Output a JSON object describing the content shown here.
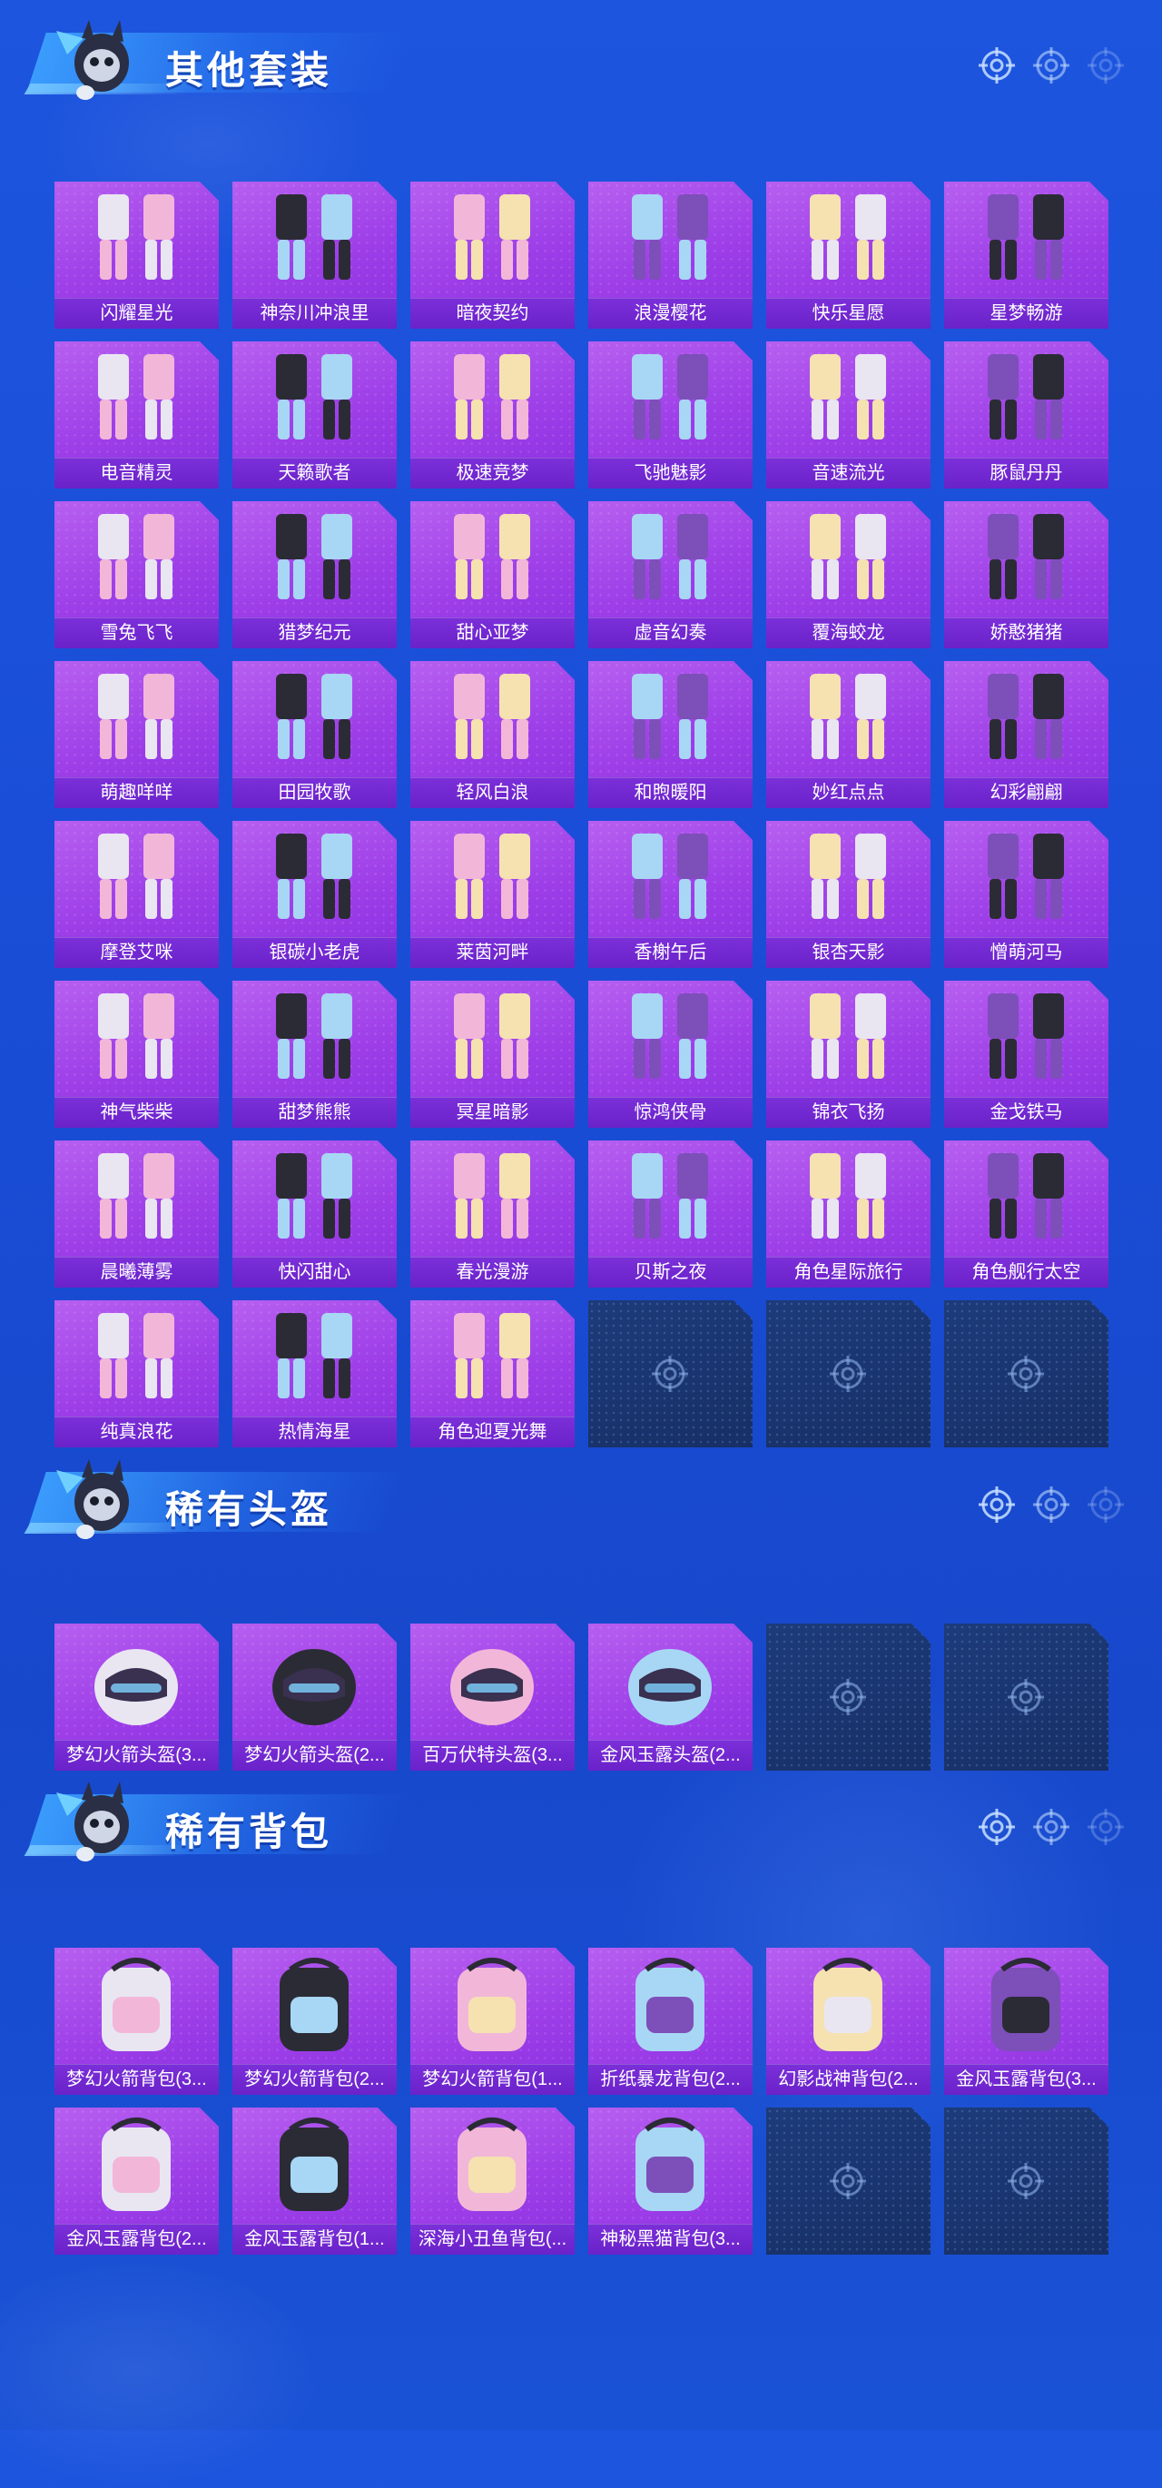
{
  "sections": [
    {
      "title": "其他套装",
      "items": [
        "闪耀星光",
        "神奈川冲浪里",
        "暗夜契约",
        "浪漫樱花",
        "快乐星愿",
        "星梦畅游",
        "电音精灵",
        "天籁歌者",
        "极速竞梦",
        "飞驰魅影",
        "音速流光",
        "豚鼠丹丹",
        "雪兔飞飞",
        "猎梦纪元",
        "甜心亚梦",
        "虚音幻奏",
        "覆海蛟龙",
        "娇憨猪猪",
        "萌趣咩咩",
        "田园牧歌",
        "轻风白浪",
        "和煦暖阳",
        "妙红点点",
        "幻彩翩翩",
        "摩登艾咪",
        "银碳小老虎",
        "莱茵河畔",
        "香榭午后",
        "银杏天影",
        "憎萌河马",
        "神气柴柴",
        "甜梦熊熊",
        "冥星暗影",
        "惊鸿侠骨",
        "锦衣飞扬",
        "金戈铁马",
        "晨曦薄雾",
        "快闪甜心",
        "春光漫游",
        "贝斯之夜",
        "角色星际旅行",
        "角色舰行太空",
        "纯真浪花",
        "热情海星",
        "角色迎夏光舞"
      ],
      "empty_slots": 3
    },
    {
      "title": "稀有头盔",
      "items": [
        "梦幻火箭头盔(3...",
        "梦幻火箭头盔(2...",
        "百万伏特头盔(3...",
        "金风玉露头盔(2..."
      ],
      "empty_slots": 2
    },
    {
      "title": "稀有背包",
      "items": [
        "梦幻火箭背包(3...",
        "梦幻火箭背包(2...",
        "梦幻火箭背包(1...",
        "折纸暴龙背包(2...",
        "幻影战神背包(2...",
        "金风玉露背包(3...",
        "金风玉露背包(2...",
        "金风玉露背包(1...",
        "深海小丑鱼背包(...",
        "神秘黑猫背包(3..."
      ],
      "empty_slots": 2
    }
  ],
  "colors": {
    "background": "#1a4ed8",
    "item_purple": "#9d3ee8",
    "label_purple": "#6a22c9",
    "empty_slot": "#172f66"
  },
  "icons": {
    "header_right": [
      "crosshair-icon",
      "crosshair-icon",
      "crosshair-icon"
    ],
    "mascot": "mascot-icon"
  }
}
